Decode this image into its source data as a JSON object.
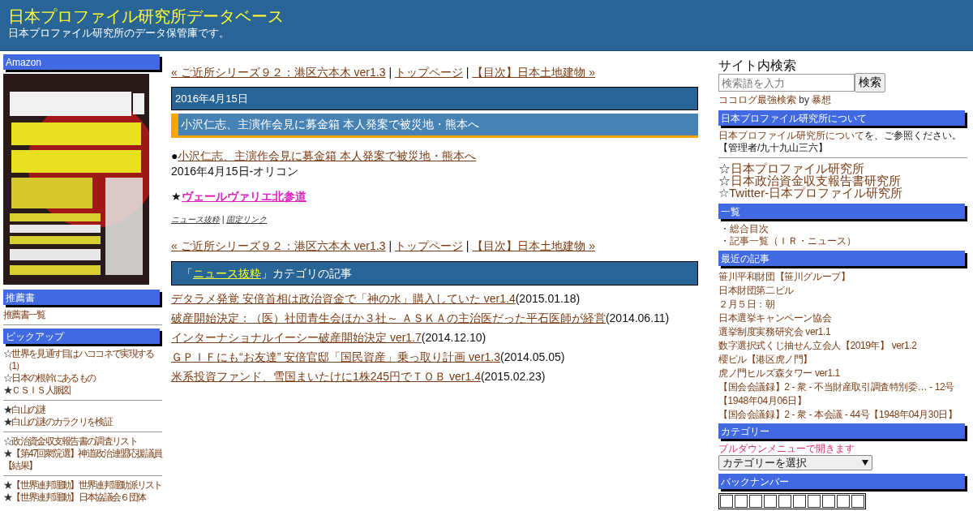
{
  "header": {
    "title": "日本プロファイル研究所データベース",
    "subtitle": "日本プロファイル研究所のデータ保管庫です。"
  },
  "left_sidebar": [
    {
      "title": "Amazon",
      "kind": "picture"
    },
    {
      "title": "推薦書",
      "kind": "links",
      "groups": [
        [
          {
            "text": "推薦書一覧"
          }
        ]
      ]
    },
    {
      "title": "ピックアップ",
      "kind": "links",
      "groups": [
        [
          {
            "mark": "☆",
            "text": "世界を見通す目はハココネで実現する（1）"
          },
          {
            "mark": "☆",
            "text": "日本の根幹にあるもの"
          },
          {
            "mark": "★",
            "text": "ＣＳＩＳ人脈図"
          }
        ],
        [
          {
            "mark": "★",
            "text": "白山の謎"
          },
          {
            "mark": "★",
            "text": "白山の謎のカラクリを検証"
          }
        ],
        [
          {
            "mark": "☆",
            "text": "政治資金収支報告書の調査リスト"
          },
          {
            "mark": "★",
            "text": "【第47回衆院選】神道政治連盟応援議員【結果】"
          }
        ],
        [
          {
            "mark": "★",
            "text": "【世界連邦運動】世界連邦運動派リスト"
          },
          {
            "mark": "★",
            "text": "【世界連邦運動】日本協議会６団体"
          }
        ]
      ]
    }
  ],
  "main": {
    "nav_top": {
      "prev": "« ご近所シリーズ９２：港区六本木 ver1.3",
      "top": "トップページ",
      "next": "【目次】日本土地建物 »",
      "separator": "|"
    },
    "nav_bottom": {
      "prev": "« ご近所シリーズ９２：港区六本木 ver1.3",
      "top": "トップページ",
      "next": "【目次】日本土地建物 »",
      "separator": "|"
    },
    "date": "2016年4月15日",
    "entry_title": "小沢仁志、主演作会見に募金箱 本人発案で被災地・熊本へ",
    "body": {
      "bullet": "●",
      "link": "小沢仁志、主演作会見に募金箱 本人発案で被災地・熊本へ",
      "source": "2016年4月15日-オリコン",
      "star": "★",
      "promo": "ヴェールヴァリエ北参道"
    },
    "footer": {
      "category": "ニュース抜粋",
      "separator": "|",
      "permalink": "固定リンク"
    },
    "category_header": {
      "open": "「",
      "link": "ニュース抜粋",
      "close": "」カテゴリの記事"
    },
    "category_articles": [
      {
        "title": "デタラメ発覚 安倍首相は政治資金で「神の水」購入していた ver1.4",
        "date": "(2015.01.18)"
      },
      {
        "title": "破産開始決定：（医）社団青生会ほか３社～ ＡＳＫＡの主治医だった平石医師が経営",
        "date": "(2014.06.11)"
      },
      {
        "title": "インターナショナルイーシー破産開始決定 ver1.7",
        "date": "(2014.12.10)"
      },
      {
        "title": "ＧＰＩＦにも“お友達” 安倍官邸「国民資産」乗っ取り計画 ver1.3",
        "date": "(2014.05.05)"
      },
      {
        "title": "米系投資ファンド、雪国まいたけに1株245円でＴＯＢ ver1.4",
        "date": "(2015.02.23)"
      }
    ]
  },
  "right_sidebar": {
    "search": {
      "title": "サイト内検索",
      "placeholder": "検索語を入力",
      "button": "検索",
      "credit_link": "ココログ最強検索",
      "credit_by": "by",
      "credit_author": "暴想"
    },
    "about": {
      "title": "日本プロファイル研究所について",
      "link": "日本プロファイル研究所について",
      "text": "を、ご参照ください。",
      "admin": "【管理者/九十九山三六】"
    },
    "sites": [
      {
        "mark": "☆",
        "text": "日本プロファイル研究所"
      },
      {
        "mark": "☆",
        "text": "日本政治資金収支報告書研究所"
      },
      {
        "mark": "☆",
        "text": "Twitter-日本プロファイル研究所"
      }
    ],
    "index": {
      "title": "一覧",
      "items": [
        {
          "mark": "・",
          "text": "総合目次"
        },
        {
          "mark": "・",
          "text": "記事一覧（ＩＲ・ニュース）"
        }
      ]
    },
    "recent": {
      "title": "最近の記事",
      "items": [
        "笹川平和財団【笹川グループ】",
        "日本財団第二ビル",
        "２月５日：朝",
        "日本選挙キャンペーン協会",
        "選挙制度実務研究会 ver1.1",
        "数字選択式くじ抽せん立会人【2019年】 ver1.2",
        "櫻ビル【港区虎ノ門】",
        "虎ノ門ヒルズ森タワー ver1.1",
        "【国会会議録】2 - 衆 - 不当財産取引調査特別委… - 12号【1948年04月06日】",
        "【国会会議録】2 - 衆 - 本会議 - 44号【1948年04月30日】"
      ]
    },
    "categories": {
      "title": "カテゴリー",
      "note": "プルダウンメニューで開きます",
      "select": "カテゴリーを選択"
    },
    "backnumber": {
      "title": "バックナンバー"
    }
  }
}
